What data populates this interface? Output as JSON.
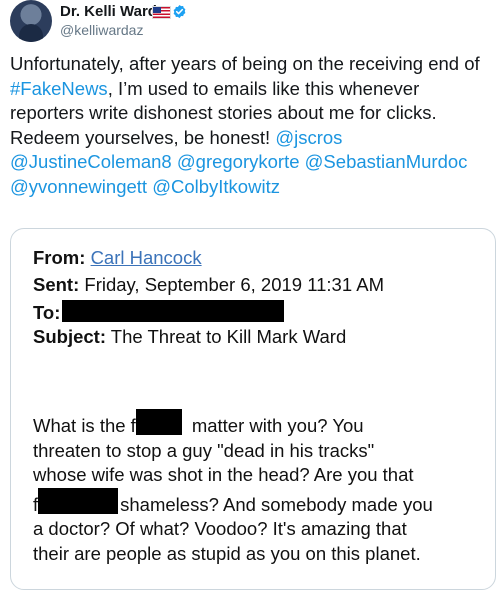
{
  "user": {
    "display_name": "Dr. Kelli Ward",
    "handle": "@kelliwardaz"
  },
  "tweet": {
    "line1": "Unfortunately, after years of being on the receiving end of",
    "hashtag": "#FakeNews",
    "line2_rest": ", I’m used to emails like this whenever",
    "line3": "reporters write dishonest stories about me for clicks.",
    "line4_text": "Redeem yourselves, be honest! ",
    "mentions": [
      "@jscros",
      "@JustineColeman8",
      "@gregorykorte",
      "@SebastianMurdoc",
      "@yvonnewingett",
      "@ColbyItkowitz"
    ]
  },
  "email": {
    "from_label": "From:",
    "from_value": "Carl Hancock",
    "sent_label": "Sent:",
    "sent_value": "Friday, September 6, 2019 11:31 AM",
    "to_label": "To:",
    "subject_label": "Subject:",
    "subject_value": "The Threat to Kill Mark Ward",
    "body": {
      "l1a": "What is the f",
      "l1b": "matter with you?  You",
      "l2": "threaten to stop a guy \"dead in his tracks\"",
      "l3": "whose wife was shot in the head?  Are you that",
      "l4a": "f",
      "l4b": "shameless?  And somebody made you",
      "l5": "a doctor?  Of what?  Voodoo?  It's amazing that",
      "l6": "their are people as stupid as you on this planet."
    }
  },
  "colors": {
    "link": "#1b95e0",
    "verified": "#1da1f2",
    "email_link": "#3b73b9"
  }
}
